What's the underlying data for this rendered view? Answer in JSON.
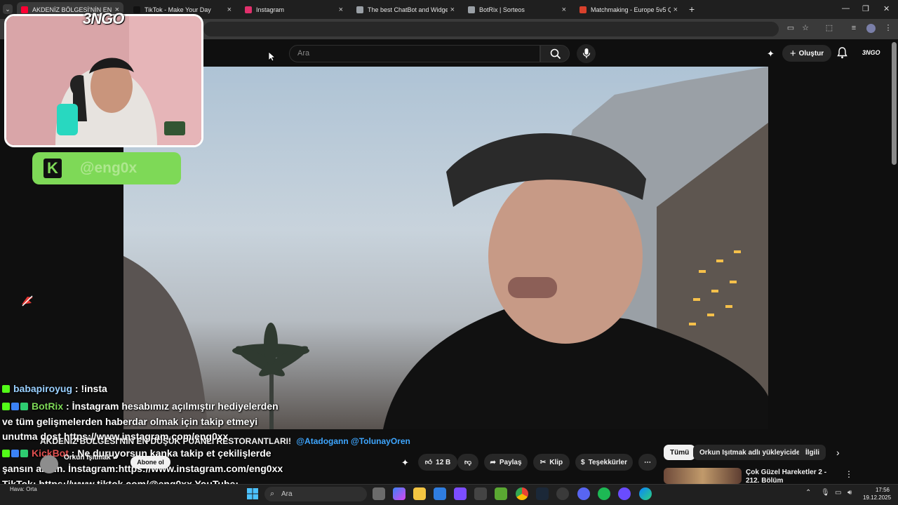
{
  "browser": {
    "tabs": [
      {
        "title": "AKDENİZ BÖLGESİ'NİN EN DÜŞÜK PUANLI RESTORANTLARI!",
        "color": "#ff0033"
      },
      {
        "title": "TikTok - Make Your Day",
        "color": "#111111"
      },
      {
        "title": "Instagram",
        "color": "#e1306c"
      },
      {
        "title": "The best ChatBot and Widgets",
        "color": "#9aa0a6"
      },
      {
        "title": "BotRix | Sorteos",
        "color": "#9aa0a6"
      },
      {
        "title": "Matchmaking - Europe 5v5 Quick",
        "color": "#d9412c"
      }
    ]
  },
  "youtube": {
    "search_placeholder": "Ara",
    "create_label": "Oluştur",
    "avatar_label": "3NGO"
  },
  "overlay": {
    "cam_logo": "3NGO",
    "kick_handle": "@eng0x",
    "kick_letter": "K"
  },
  "chat": [
    {
      "user": "babapiroyug",
      "user_color": "#9ad0ff",
      "text": " : !insta"
    },
    {
      "user": "BotRix",
      "user_color": "#7ed957",
      "text": " : İnstagram hesabımız açılmıştır hediyelerden"
    },
    {
      "user": "",
      "user_color": "#ffffff",
      "text": "ve tüm gelişmelerden haberdar olmak için takip etmeyi"
    },
    {
      "user": "",
      "user_color": "#ffffff",
      "text": "unutma dost https://www.instagram.com/eng0xx"
    },
    {
      "user": "KickBot",
      "user_color": "#e05050",
      "text": " : Ne duruyorsun kanka takip et çekilişlerde"
    },
    {
      "user": "",
      "user_color": "#ffffff",
      "text": "şansın artsın. İnstagram:https://www.instagram.com/eng0xx"
    },
    {
      "user": "",
      "user_color": "#ffffff",
      "text": "TikTok: https://www.tiktok.com/@eng0xx YouTube:"
    },
    {
      "user": "",
      "user_color": "#ffffff",
      "text": "https://www.youtube.com/@eng0Xx"
    }
  ],
  "video": {
    "title": "AKDENİZ BÖLGESİ'NİN EN DÜŞÜK PUANLI RESTORANTLARI!",
    "mentions": "@Atadogann @TolunayOren",
    "channel_name": "Orkun Işıtmak",
    "subscribe_label": "Abone ol",
    "like_count": "12 B",
    "share_label": "Paylaş",
    "clip_label": "Klip",
    "thanks_label": "Teşekkürler"
  },
  "sidebar": {
    "chips": [
      "Tümü",
      "Orkun Işıtmak adlı yükleyiciden",
      "İlgili"
    ],
    "next_video_title": "Çok Güzel Hareketler 2 - 212. Bölüm"
  },
  "taskbar": {
    "search_label": "Ara",
    "weather": "Hava: Orta",
    "time": "17:56",
    "date": "19.12.2025"
  },
  "colors": {
    "accent_green": "#7ed957",
    "mention_blue": "#3ea6ff"
  }
}
